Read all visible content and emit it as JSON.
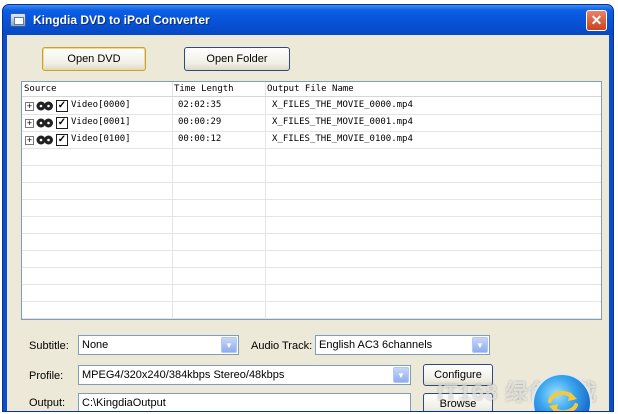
{
  "window": {
    "title": "Kingdia DVD to iPod Converter",
    "close_glyph": "✕",
    "title_bar_color": "#0753d8",
    "client_color": "#ece9d8"
  },
  "toolbar": {
    "open_dvd_label": "Open DVD",
    "open_folder_label": "Open Folder"
  },
  "list": {
    "columns": [
      "Source",
      "Time Length",
      "Output File Name"
    ],
    "rows": [
      {
        "source": "Video[0000]",
        "time": "02:02:35",
        "output": "X_FILES_THE_MOVIE_0000.mp4",
        "checked": true
      },
      {
        "source": "Video[0001]",
        "time": "00:00:29",
        "output": "X_FILES_THE_MOVIE_0001.mp4",
        "checked": true
      },
      {
        "source": "Video[0100]",
        "time": "00:00:12",
        "output": "X_FILES_THE_MOVIE_0100.mp4",
        "checked": true
      }
    ],
    "expander_glyph": "+",
    "check_glyph": "✓"
  },
  "settings": {
    "subtitle_label": "Subtitle:",
    "subtitle_value": "None",
    "audio_track_label": "Audio Track:",
    "audio_track_value": "English AC3 6channels",
    "profile_label": "Profile:",
    "profile_value": "MPEG4/320x240/384kbps Stereo/48kbps",
    "configure_label": "Configure",
    "output_label": "Output:",
    "output_value": "C:\\KingdiaOutput",
    "browse_label": "Browse",
    "dropdown_glyph": "▼"
  },
  "watermark_text": "IT168 绿色下载",
  "icons": {
    "app": "dvd-app-icon",
    "close": "close-icon",
    "film": "film-reel-icon",
    "convert": "convert-arrows-icon"
  }
}
